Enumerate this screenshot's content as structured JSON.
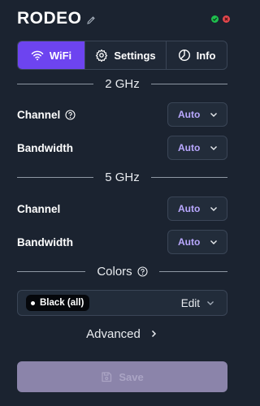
{
  "header": {
    "title": "RODEO"
  },
  "tabs": [
    {
      "label": "WiFi",
      "icon": "wifi-icon",
      "active": true
    },
    {
      "label": "Settings",
      "icon": "gear-icon",
      "active": false
    },
    {
      "label": "Info",
      "icon": "info-icon",
      "active": false
    }
  ],
  "band_2ghz": {
    "title": "2 GHz",
    "channel": {
      "label": "Channel",
      "value": "Auto"
    },
    "bandwidth": {
      "label": "Bandwidth",
      "value": "Auto"
    }
  },
  "band_5ghz": {
    "title": "5 GHz",
    "channel": {
      "label": "Channel",
      "value": "Auto"
    },
    "bandwidth": {
      "label": "Bandwidth",
      "value": "Auto"
    }
  },
  "colors": {
    "title": "Colors",
    "chip_label": "Black (all)",
    "edit_label": "Edit"
  },
  "advanced": {
    "label": "Advanced"
  },
  "save": {
    "label": "Save"
  },
  "theme": {
    "background": "#1b2330",
    "accent": "#6d44f0",
    "select_text": "#b9a8ff",
    "status_green": "#1fbf4e",
    "status_red": "#e5484d"
  }
}
